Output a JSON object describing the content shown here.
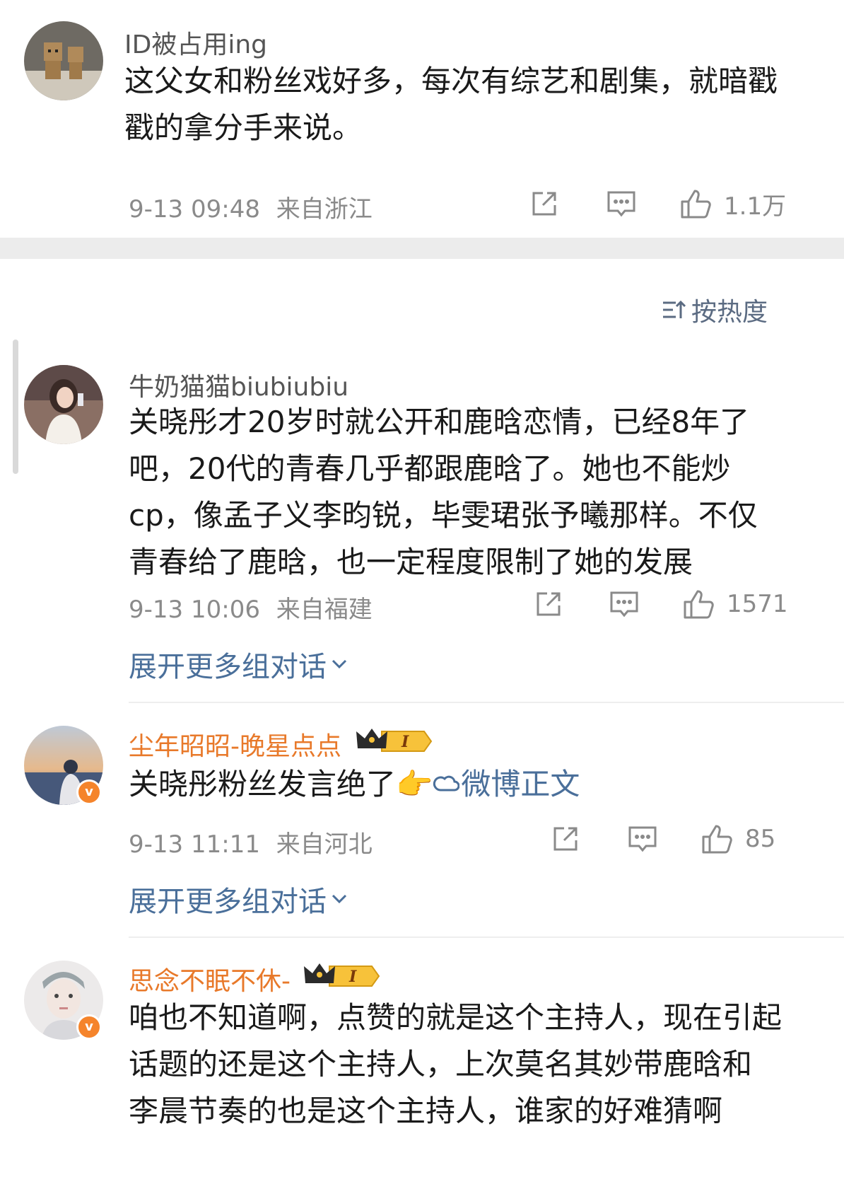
{
  "top_comment": {
    "username": "ID被占用ing",
    "lines": [
      "这父女和粉丝戏好多，每次有综艺和剧集，就暗戳",
      "戳的拿分手来说。"
    ],
    "time": "9-13 09:48",
    "location": "来自浙江",
    "likes": "1.1万"
  },
  "sort_label": "按热度",
  "comments": [
    {
      "username": "牛奶猫猫biubiubiu",
      "lines": [
        "关晓彤才20岁时就公开和鹿晗恋情，已经8年了",
        "吧，20代的青春几乎都跟鹿晗了。她也不能炒",
        "cp，像孟子义李昀锐，毕雯珺张予曦那样。不仅",
        "青春给了鹿晗，也一定程度限制了她的发展"
      ],
      "time": "9-13 10:06",
      "location": "来自福建",
      "likes": "1571",
      "expand_label": "展开更多组对话"
    },
    {
      "username": "尘年昭昭-晚星点点",
      "vip_level": "I",
      "text": "关晓彤粉丝发言绝了",
      "emoji": "👉",
      "link_text": "微博正文",
      "time": "9-13 11:11",
      "location": "来自河北",
      "likes": "85",
      "expand_label": "展开更多组对话"
    },
    {
      "username": "思念不眠不休-",
      "vip_level": "I",
      "lines": [
        "咱也不知道啊，点赞的就是这个主持人，现在引起",
        "话题的还是这个主持人，上次莫名其妙带鹿晗和",
        "李晨节奏的也是这个主持人，谁家的好难猜啊"
      ]
    }
  ],
  "colors": {
    "vip_name": "#e8792a",
    "link": "#4a6f9a",
    "meta": "#8a8a8a",
    "verified_badge": "#f5842b"
  }
}
